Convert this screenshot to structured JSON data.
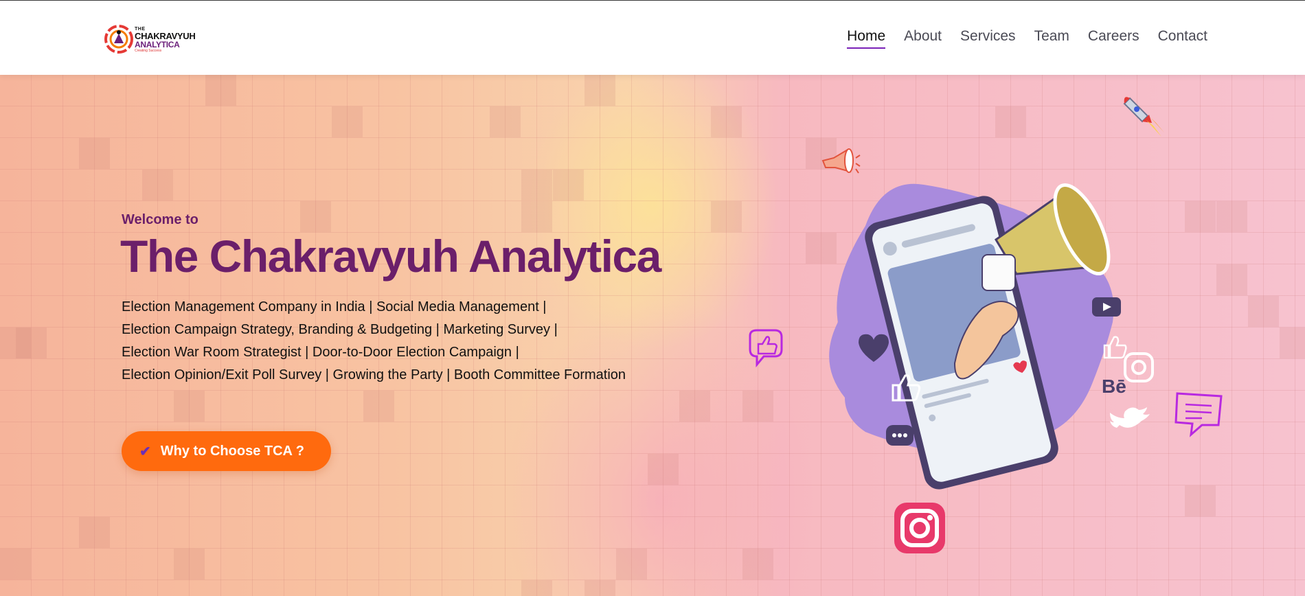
{
  "header": {
    "logo": {
      "line1": "THE",
      "line2": "CHAKRAVYUH",
      "line3": "ANALYTICA",
      "tagline": "Creating Success"
    },
    "nav": [
      {
        "label": "Home",
        "active": true
      },
      {
        "label": "About"
      },
      {
        "label": "Services"
      },
      {
        "label": "Team"
      },
      {
        "label": "Careers"
      },
      {
        "label": "Contact"
      }
    ]
  },
  "hero": {
    "welcome": "Welcome to",
    "title": "The Chakravyuh Analytica",
    "description_lines": [
      "Election Management Company in India | Social Media Management |",
      "Election Campaign Strategy, Branding & Budgeting | Marketing Survey |",
      "Election War Room Strategist | Door-to-Door Election Campaign |",
      "Election Opinion/Exit Poll Survey | Growing the Party | Booth Committee Formation"
    ],
    "cta_label": "Why to Choose TCA ?",
    "illustration_text": "Bē"
  },
  "colors": {
    "brand_purple": "#6b1f6a",
    "cta_orange": "#ff6a0e",
    "nav_underline": "#7a22b8"
  },
  "icons": [
    "logo-emblem-icon",
    "check-icon",
    "megaphone-icon",
    "rocket-icon",
    "thumbs-up-icon",
    "heart-icon",
    "chat-icon",
    "instagram-icon",
    "twitter-icon",
    "youtube-icon",
    "behance-icon",
    "message-icon",
    "phone-icon"
  ]
}
